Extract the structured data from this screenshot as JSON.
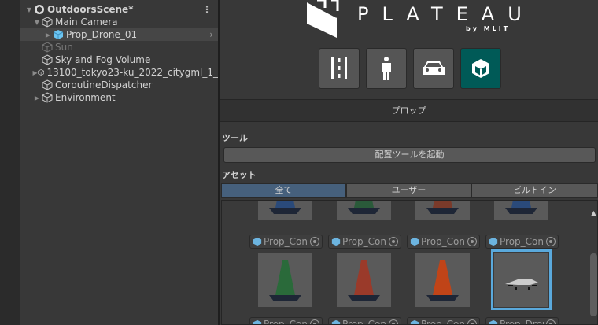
{
  "hierarchy": {
    "scene": "OutdoorsScene*",
    "items": [
      {
        "label": "Main Camera"
      },
      {
        "label": "Prop_Drone_01"
      },
      {
        "label": "Sun"
      },
      {
        "label": "Sky and Fog Volume"
      },
      {
        "label": "13100_tokyo23-ku_2022_citygml_1_"
      },
      {
        "label": "CoroutineDispatcher"
      },
      {
        "label": "Environment"
      }
    ]
  },
  "brand": {
    "name": "PLATEAU",
    "sub": "by MLIT"
  },
  "categories": [
    {
      "name": "road"
    },
    {
      "name": "pedestrian"
    },
    {
      "name": "car"
    },
    {
      "name": "prop",
      "active": true
    }
  ],
  "panel": {
    "header": "プロップ",
    "tools_label": "ツール",
    "launch_button": "配置ツールを起動",
    "assets_label": "アセット",
    "tabs": [
      "全て",
      "ユーザー",
      "ビルトイン"
    ]
  },
  "assets": [
    "Prop_Cone",
    "Prop_Cone",
    "Prop_Cone",
    "Prop_Cone",
    "Prop_Cone",
    "Prop_Cone",
    "Prop_Cone",
    "Prop_Drone"
  ],
  "colors": {
    "accent": "#005a57",
    "tab_active": "#46607c",
    "selection": "#5aa9dc"
  }
}
